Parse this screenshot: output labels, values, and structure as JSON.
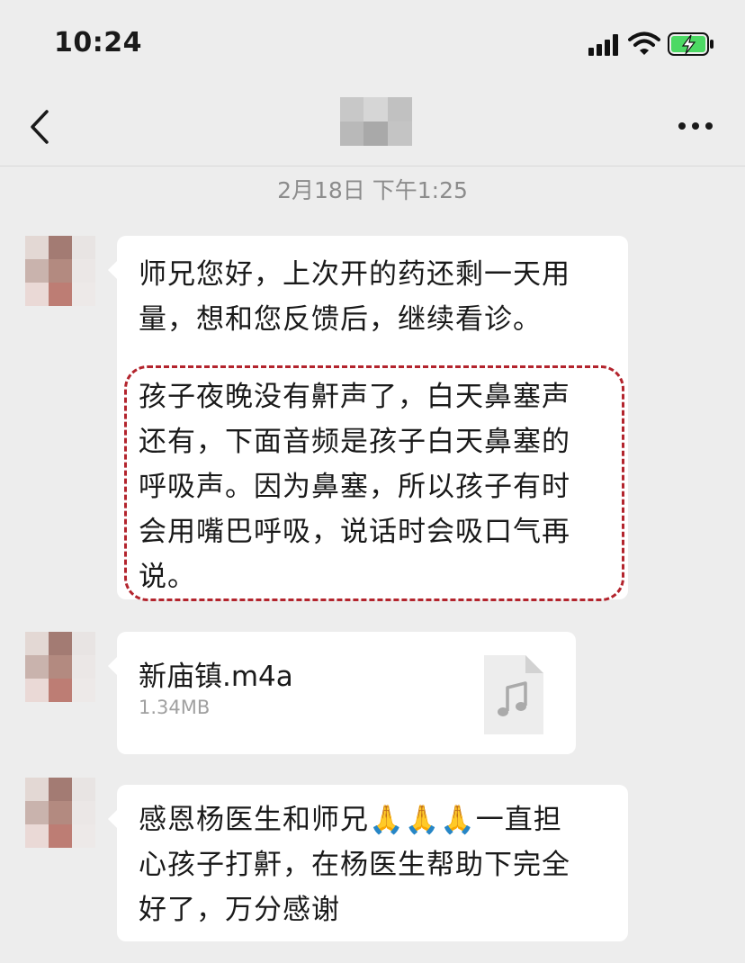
{
  "status_bar": {
    "time": "10:24",
    "battery_color": "#4cd964"
  },
  "header": {
    "back_icon": "chevron-left-icon",
    "more_icon": "more-horizontal-icon"
  },
  "chat": {
    "timestamp": "2月18日 下午1:25",
    "messages": [
      {
        "type": "text",
        "paragraphs": [
          [
            "师兄您好，上次开的药还剩一天用",
            "量，想和您反馈后，继续看诊。"
          ],
          [
            "孩子夜晚没有鼾声了，白天鼻塞声",
            "还有，下面音频是孩子白天鼻塞的",
            "呼吸声。因为鼻塞，所以孩子有时",
            "会用嘴巴呼吸，说话时会吸口气再",
            "说。"
          ]
        ],
        "highlight_color": "#b3242d"
      },
      {
        "type": "file",
        "file_name": "新庙镇.m4a",
        "file_size": "1.34MB",
        "icon": "music-file-icon"
      },
      {
        "type": "text",
        "lines": [
          "感恩杨医生和师兄🙏🙏🙏一直担",
          "心孩子打鼾，在杨医生帮助下完全",
          "好了，万分感谢"
        ]
      }
    ]
  }
}
